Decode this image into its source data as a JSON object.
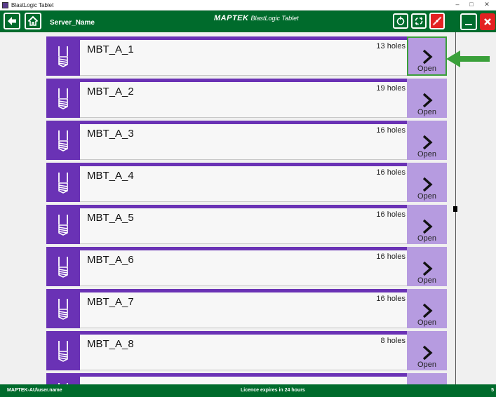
{
  "window": {
    "title": "BlastLogic Tablet",
    "controls": [
      "–",
      "□",
      "✕"
    ]
  },
  "toolbar": {
    "server_name": "Server_Name",
    "brand_logo": "MAPTEK",
    "brand_product": "BlastLogic Tablet"
  },
  "blasts": [
    {
      "name": "MBT_A_1",
      "holes": "13 holes",
      "open_label": "Open",
      "selected": true
    },
    {
      "name": "MBT_A_2",
      "holes": "19 holes",
      "open_label": "Open"
    },
    {
      "name": "MBT_A_3",
      "holes": "16 holes",
      "open_label": "Open"
    },
    {
      "name": "MBT_A_4",
      "holes": "16 holes",
      "open_label": "Open"
    },
    {
      "name": "MBT_A_5",
      "holes": "16 holes",
      "open_label": "Open"
    },
    {
      "name": "MBT_A_6",
      "holes": "16 holes",
      "open_label": "Open"
    },
    {
      "name": "MBT_A_7",
      "holes": "16 holes",
      "open_label": "Open"
    },
    {
      "name": "MBT_A_8",
      "holes": "8 holes",
      "open_label": "Open"
    }
  ],
  "status": {
    "user": "MAPTEK-AU\\user.name",
    "licence": "Licence expires in 24 hours",
    "trailing": "5"
  },
  "colors": {
    "toolbar_green": "#006b2c",
    "card_purple": "#6a32b5",
    "open_lavender": "#b69be0",
    "highlight_green": "#3aa03a",
    "close_red": "#e32222"
  },
  "icons": {
    "back": "arrow-left-icon",
    "home": "home-icon",
    "refresh": "refresh-icon",
    "sync": "sync-icon",
    "disconnect": "disconnect-icon",
    "minimize": "minimize-icon",
    "close": "close-icon",
    "drill_hole": "drill-hole-icon",
    "open": "chevron-right-icon",
    "pointer": "arrow-left-annotation-icon"
  }
}
